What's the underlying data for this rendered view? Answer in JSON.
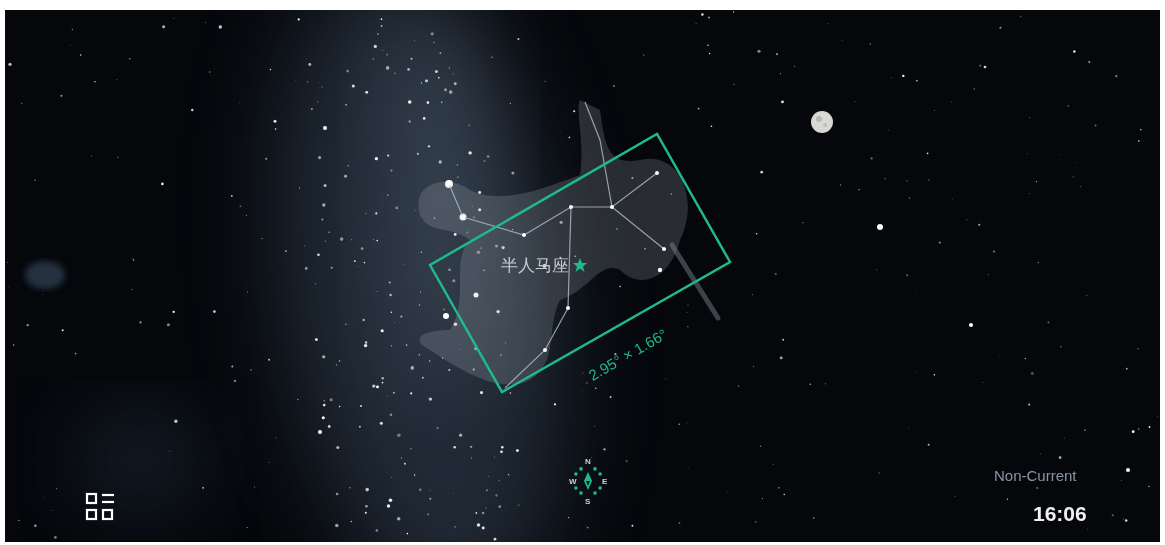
{
  "sky": {
    "constellation": {
      "name": "半人马座"
    },
    "field_of_view": {
      "label": "2.95° × 1.66°"
    }
  },
  "compass": {
    "north": "N",
    "east": "E",
    "south": "S",
    "west": "W"
  },
  "time_panel": {
    "mode": "Non-Current",
    "time": "16:06"
  }
}
